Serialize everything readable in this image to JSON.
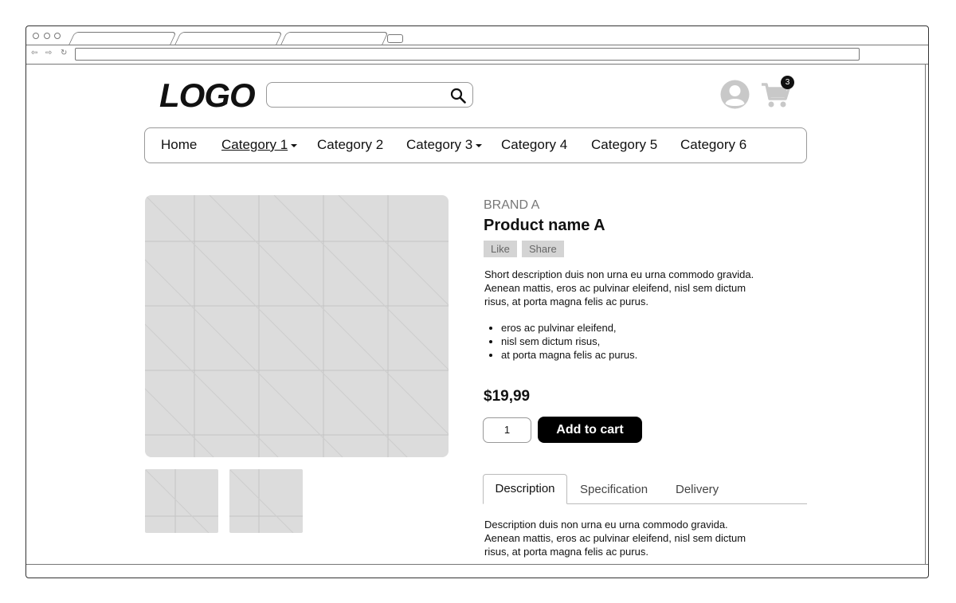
{
  "header": {
    "logo": "LOGO",
    "search": {
      "placeholder": "",
      "value": ""
    },
    "cart_count": "3"
  },
  "nav": {
    "items": [
      {
        "label": "Home",
        "active": false,
        "dropdown": false
      },
      {
        "label": "Category 1",
        "active": true,
        "dropdown": true
      },
      {
        "label": "Category 2",
        "active": false,
        "dropdown": false
      },
      {
        "label": "Category 3",
        "active": false,
        "dropdown": true
      },
      {
        "label": "Category 4",
        "active": false,
        "dropdown": false
      },
      {
        "label": "Category 5",
        "active": false,
        "dropdown": false
      },
      {
        "label": "Category 6",
        "active": false,
        "dropdown": false
      }
    ]
  },
  "product": {
    "brand": "BRAND A",
    "name": "Product name A",
    "like_label": "Like",
    "share_label": "Share",
    "short_description": "Short description duis non urna eu urna commodo gravida. Aenean mattis, eros ac pulvinar eleifend, nisl sem dictum risus, at porta magna felis ac purus.",
    "bullets": [
      "eros ac pulvinar eleifend,",
      "nisl sem dictum risus,",
      "at porta magna felis ac purus."
    ],
    "price": "$19,99",
    "quantity": "1",
    "add_to_cart_label": "Add to cart"
  },
  "tabs": {
    "items": [
      "Description",
      "Specification",
      "Delivery"
    ],
    "active": "Description",
    "content": "Description duis non urna eu urna commodo gravida. Aenean mattis, eros ac pulvinar eleifend, nisl sem dictum risus, at porta magna felis ac purus."
  },
  "colors": {
    "primary_button": "#000000",
    "image_placeholder": "#dcdcdc",
    "pill_background": "#d4d4d4"
  }
}
